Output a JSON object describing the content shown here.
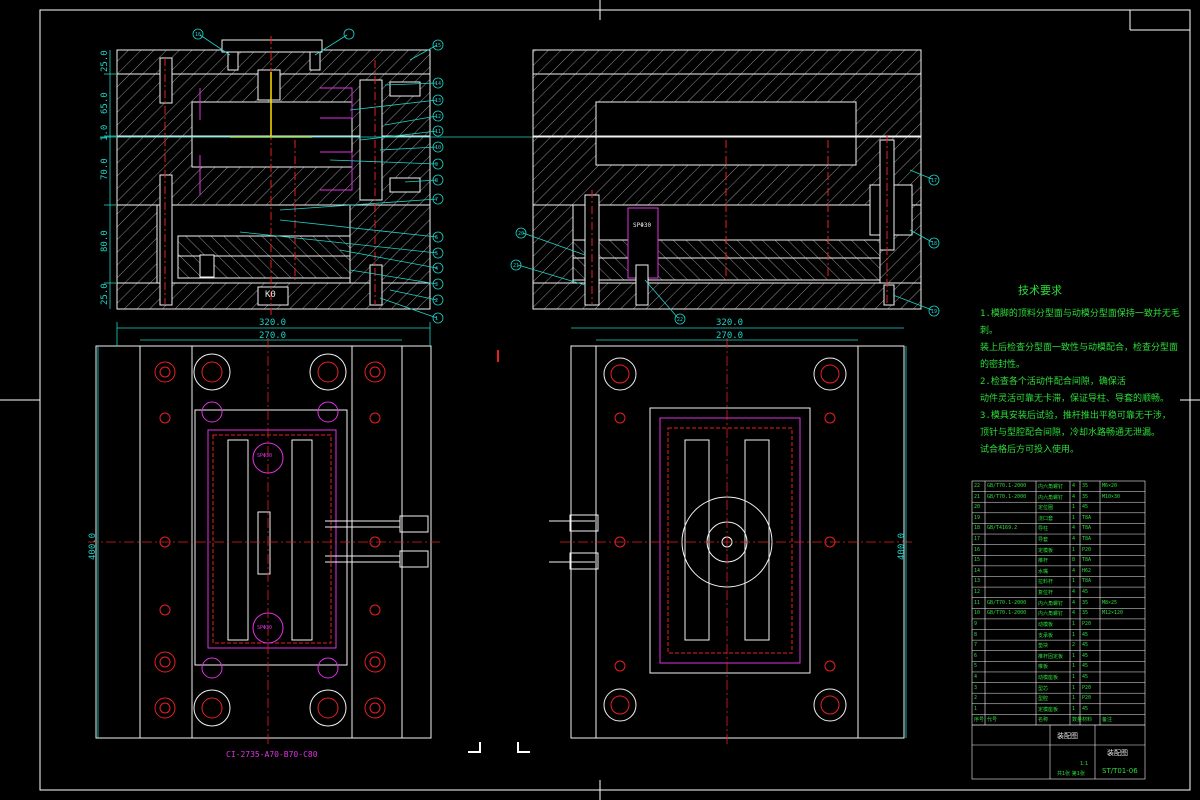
{
  "drawing": {
    "background": "#000000",
    "line_colors": {
      "outline": "#f2f2f2",
      "hatch": "#d8d8d8",
      "dimension": "#1fd3c8",
      "centerline": "#e82020",
      "text": "#2dde3a",
      "cooling": "#e032e0",
      "pin": "#ffe000"
    }
  },
  "dims": {
    "left_w1": "320.0",
    "left_w2": "270.0",
    "left_h": "400.0",
    "right_w1": "320.0",
    "right_w2": "270.0",
    "right_h": "400.0",
    "sec_1": "25.0",
    "sec_2": "65.0",
    "sec_3": "1.0",
    "sec_4": "70.0",
    "sec_5": "80.0",
    "sec_6": "25.0"
  },
  "labels": {
    "k0": "K0",
    "sp_top": "SPΦ30",
    "sp_bottom": "SPΦ30",
    "sp_center": "SPΦ30"
  },
  "mold_base_spec": "CI-2735-A70-B70-C80",
  "tech_req": {
    "title": "技术要求",
    "lines": [
      "1.模脚的顶料分型面与动模分型面保持一致并无毛刺。",
      "装上后检查分型面一致性与动模配合，检查分型面的密封性。",
      "2.检查各个活动件配合间隙，确保活",
      "动件灵活可靠无卡滞，保证导柱、导套的顺畅。",
      "3.模具安装后试验，推杆推出平稳可靠无干涉，",
      "顶针与型腔配合间隙，冷却水路畅通无泄漏。",
      "试合格后方可投入使用。"
    ]
  },
  "bom": {
    "rows": [
      {
        "no": "22",
        "code": "GB/T70.1-2000",
        "name": "内六角螺钉",
        "qty": "4",
        "mat": "35",
        "note": "M6×20"
      },
      {
        "no": "21",
        "code": "GB/T70.1-2000",
        "name": "内六角螺钉",
        "qty": "4",
        "mat": "35",
        "note": "M10×30"
      },
      {
        "no": "20",
        "code": "",
        "name": "定位圈",
        "qty": "1",
        "mat": "45",
        "note": ""
      },
      {
        "no": "19",
        "code": "",
        "name": "浇口套",
        "qty": "1",
        "mat": "T8A",
        "note": ""
      },
      {
        "no": "18",
        "code": "GB/T4169.2",
        "name": "导柱",
        "qty": "4",
        "mat": "T8A",
        "note": ""
      },
      {
        "no": "17",
        "code": "",
        "name": "导套",
        "qty": "4",
        "mat": "T8A",
        "note": ""
      },
      {
        "no": "16",
        "code": "",
        "name": "定模板",
        "qty": "1",
        "mat": "P20",
        "note": ""
      },
      {
        "no": "15",
        "code": "",
        "name": "推杆",
        "qty": "8",
        "mat": "T8A",
        "note": ""
      },
      {
        "no": "14",
        "code": "",
        "name": "水嘴",
        "qty": "4",
        "mat": "H62",
        "note": ""
      },
      {
        "no": "13",
        "code": "",
        "name": "拉料杆",
        "qty": "1",
        "mat": "T8A",
        "note": ""
      },
      {
        "no": "12",
        "code": "",
        "name": "复位杆",
        "qty": "4",
        "mat": "45",
        "note": ""
      },
      {
        "no": "11",
        "code": "GB/T70.1-2000",
        "name": "内六角螺钉",
        "qty": "4",
        "mat": "35",
        "note": "M8×25"
      },
      {
        "no": "10",
        "code": "GB/T70.1-2000",
        "name": "内六角螺钉",
        "qty": "4",
        "mat": "35",
        "note": "M12×120"
      },
      {
        "no": "9",
        "code": "",
        "name": "动模板",
        "qty": "1",
        "mat": "P20",
        "note": ""
      },
      {
        "no": "8",
        "code": "",
        "name": "支承板",
        "qty": "1",
        "mat": "45",
        "note": ""
      },
      {
        "no": "7",
        "code": "",
        "name": "垫块",
        "qty": "2",
        "mat": "45",
        "note": ""
      },
      {
        "no": "6",
        "code": "",
        "name": "推杆固定板",
        "qty": "1",
        "mat": "45",
        "note": ""
      },
      {
        "no": "5",
        "code": "",
        "name": "推板",
        "qty": "1",
        "mat": "45",
        "note": ""
      },
      {
        "no": "4",
        "code": "",
        "name": "动模座板",
        "qty": "1",
        "mat": "45",
        "note": ""
      },
      {
        "no": "3",
        "code": "",
        "name": "型芯",
        "qty": "1",
        "mat": "P20",
        "note": ""
      },
      {
        "no": "2",
        "code": "",
        "name": "型腔",
        "qty": "1",
        "mat": "P20",
        "note": ""
      },
      {
        "no": "1",
        "code": "",
        "name": "定模座板",
        "qty": "1",
        "mat": "45",
        "note": ""
      }
    ],
    "header": {
      "no": "序号",
      "code": "代号",
      "name": "名称",
      "qty": "数量",
      "mat": "材料",
      "note": "备注"
    }
  },
  "title_block": {
    "name": "装配图",
    "drawing_no": "ST/T01-06",
    "scale": "1:1",
    "sheet": "共1张 第1张"
  },
  "balloons": {
    "left": [
      "1",
      "2",
      "3",
      "4",
      "5",
      "6",
      "7",
      "8",
      "9",
      "10",
      "11",
      "12",
      "13",
      "14",
      "15",
      "16"
    ],
    "right": [
      "17",
      "18",
      "19",
      "20",
      "21",
      "22"
    ]
  }
}
